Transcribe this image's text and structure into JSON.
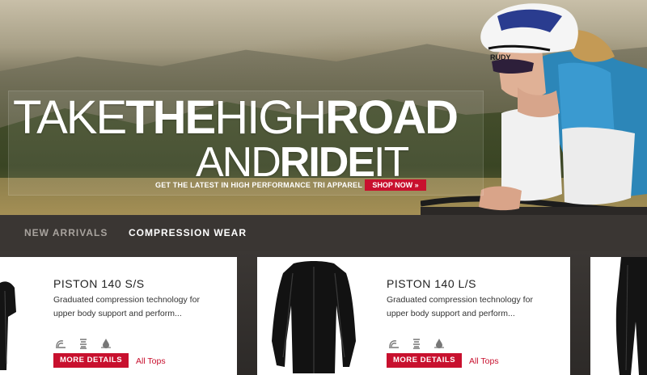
{
  "hero": {
    "headline_1_thin": "TAKE",
    "headline_1_bold": "THE",
    "headline_1_thin2": "HIGH",
    "headline_1_bold2": "ROAD",
    "headline_2_thin": "AND",
    "headline_2_bold": "RIDE",
    "headline_2_thin2": "IT",
    "subtitle": "GET THE LATEST IN HIGH PERFORMANCE TRI APPAREL",
    "cta_label": "SHOP NOW »",
    "helmet_brand": "RUDY",
    "accent_color": "#c8102e"
  },
  "nav": {
    "items": [
      {
        "label": "NEW ARRIVALS"
      },
      {
        "label": "COMPRESSION WEAR"
      }
    ]
  },
  "products": [
    {
      "name": "PISTON 140 S/S",
      "description_line1": "Graduated compression technology for",
      "description_line2": "upper body support and perform...",
      "more_label": "MORE DETAILS",
      "link_label": "All Tops"
    },
    {
      "name": "PISTON 140 L/S",
      "description_line1": "Graduated compression technology for",
      "description_line2": "upper body support and perform...",
      "more_label": "MORE DETAILS",
      "link_label": "All Tops"
    }
  ],
  "feature_icons": [
    "wind-icon",
    "compression-icon",
    "water-drop-icon"
  ]
}
